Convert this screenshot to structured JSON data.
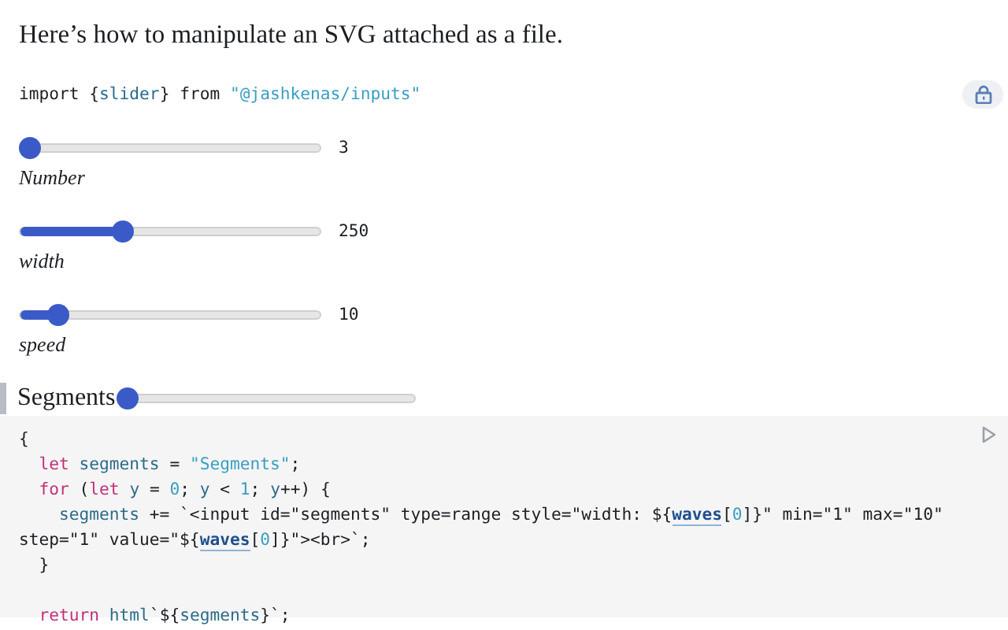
{
  "intro": "Here’s how to manipulate an SVG attached as a file.",
  "import_line": [
    {
      "text": "import {",
      "kind": "plain"
    },
    {
      "text": "slider",
      "kind": "name"
    },
    {
      "text": "} from ",
      "kind": "plain"
    },
    {
      "text": "\"@jashkenas/inputs\"",
      "kind": "string"
    }
  ],
  "sliders": [
    {
      "value": "3",
      "label": "Number",
      "level": 0
    },
    {
      "value": "250",
      "label": "width",
      "level": 0.33
    },
    {
      "value": "10",
      "label": "speed",
      "level": 0.1
    }
  ],
  "segments": {
    "label": "Segments",
    "level": 0
  },
  "code": [
    {
      "kind": "code",
      "tokens": [
        {
          "text": "{",
          "kind": "plain"
        }
      ]
    },
    {
      "kind": "code",
      "tokens": [
        {
          "text": "  let",
          "kind": "keyword"
        },
        {
          "text": " segments",
          "kind": "name"
        },
        {
          "text": " = ",
          "kind": "plain"
        },
        {
          "text": "\"Segments\"",
          "kind": "string"
        },
        {
          "text": ";",
          "kind": "plain"
        }
      ]
    },
    {
      "kind": "code",
      "tokens": [
        {
          "text": "  for",
          "kind": "keyword"
        },
        {
          "text": " (",
          "kind": "plain"
        },
        {
          "text": "let",
          "kind": "keyword"
        },
        {
          "text": " y",
          "kind": "name"
        },
        {
          "text": " = ",
          "kind": "plain"
        },
        {
          "text": "0",
          "kind": "number"
        },
        {
          "text": "; ",
          "kind": "plain"
        },
        {
          "text": "y",
          "kind": "name"
        },
        {
          "text": " < ",
          "kind": "plain"
        },
        {
          "text": "1",
          "kind": "number"
        },
        {
          "text": "; ",
          "kind": "plain"
        },
        {
          "text": "y",
          "kind": "name"
        },
        {
          "text": "++) {",
          "kind": "plain"
        }
      ]
    },
    {
      "kind": "code",
      "tokens": [
        {
          "text": "    segments",
          "kind": "name"
        },
        {
          "text": " += `<input id=\"segments\" type=range style=\"width: ${",
          "kind": "plain"
        },
        {
          "text": "waves",
          "kind": "ref"
        },
        {
          "text": "[",
          "kind": "plain"
        },
        {
          "text": "0",
          "kind": "number"
        },
        {
          "text": "]}\" min=\"1\" max=\"10\" step=\"1\" value=\"${",
          "kind": "plain"
        },
        {
          "text": "waves",
          "kind": "ref"
        },
        {
          "text": "[",
          "kind": "plain"
        },
        {
          "text": "0",
          "kind": "number"
        },
        {
          "text": "]}\"><br>`;",
          "kind": "plain"
        }
      ]
    },
    {
      "kind": "code",
      "tokens": [
        {
          "text": "  }",
          "kind": "plain"
        }
      ]
    },
    {
      "kind": "blank"
    },
    {
      "kind": "code",
      "tokens": [
        {
          "text": "  return",
          "kind": "keyword"
        },
        {
          "text": " html",
          "kind": "name"
        },
        {
          "text": "`${",
          "kind": "plain"
        },
        {
          "text": "segments",
          "kind": "name"
        },
        {
          "text": "}`;",
          "kind": "plain"
        }
      ]
    }
  ]
}
